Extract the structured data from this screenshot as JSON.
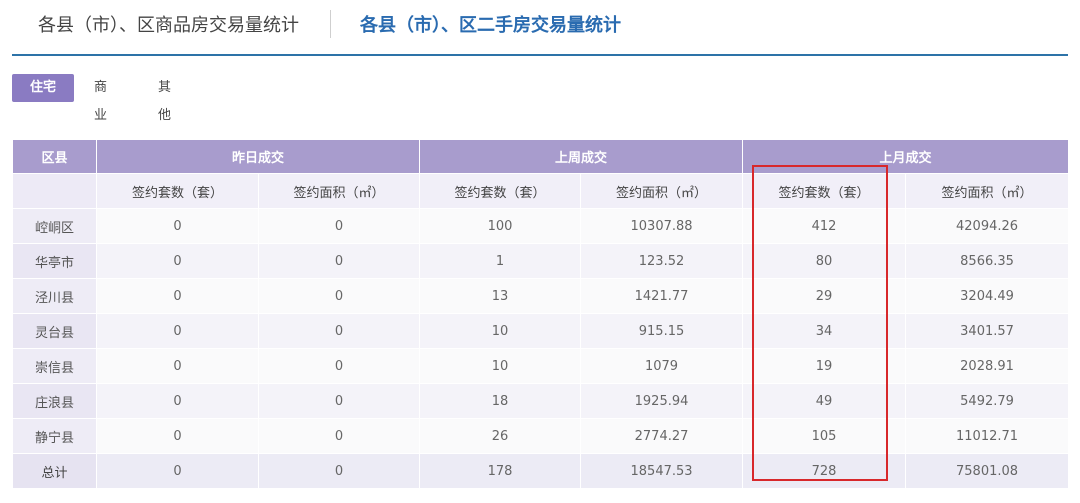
{
  "top_tabs": [
    {
      "label": "各县（市）、区商品房交易量统计"
    },
    {
      "label": "各县（市）、区二手房交易量统计"
    }
  ],
  "sub_tabs": [
    {
      "label": "住宅"
    },
    {
      "label": "商业"
    },
    {
      "label": "其他"
    }
  ],
  "table": {
    "header_row1": [
      "区县",
      "昨日成交",
      "上周成交",
      "上月成交"
    ],
    "header_row2": [
      "",
      "签约套数（套）",
      "签约面积（㎡）",
      "签约套数（套）",
      "签约面积（㎡）",
      "签约套数（套）",
      "签约面积（㎡）"
    ],
    "rows": [
      [
        "崆峒区",
        "0",
        "0",
        "100",
        "10307.88",
        "412",
        "42094.26"
      ],
      [
        "华亭市",
        "0",
        "0",
        "1",
        "123.52",
        "80",
        "8566.35"
      ],
      [
        "泾川县",
        "0",
        "0",
        "13",
        "1421.77",
        "29",
        "3204.49"
      ],
      [
        "灵台县",
        "0",
        "0",
        "10",
        "915.15",
        "34",
        "3401.57"
      ],
      [
        "崇信县",
        "0",
        "0",
        "10",
        "1079",
        "19",
        "2028.91"
      ],
      [
        "庄浪县",
        "0",
        "0",
        "18",
        "1925.94",
        "49",
        "5492.79"
      ],
      [
        "静宁县",
        "0",
        "0",
        "26",
        "2774.27",
        "105",
        "11012.71"
      ]
    ],
    "total": [
      "总计",
      "0",
      "0",
      "178",
      "18547.53",
      "728",
      "75801.08"
    ]
  },
  "highlight_color": "#d8282b",
  "accent_color": "#8a7bc2"
}
